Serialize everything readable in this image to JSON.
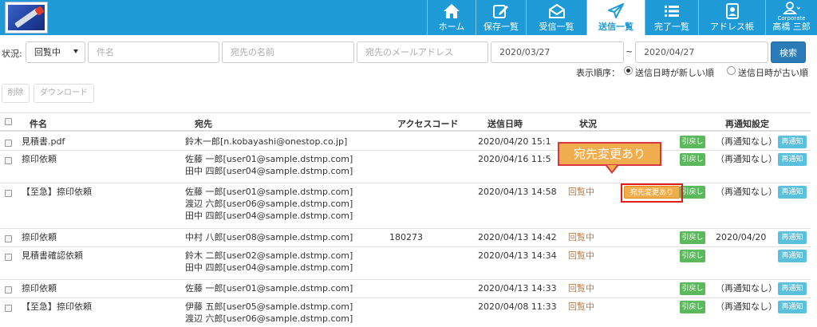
{
  "nav": {
    "home": "ホーム",
    "saved": "保存一覧",
    "inbox": "受信一覧",
    "sent": "送信一覧",
    "done": "完了一覧",
    "address": "アドレス帳",
    "corp": "Corporate",
    "user": "高橋 三郎"
  },
  "filter": {
    "label": "状況:",
    "status_value": "回覧中",
    "subject_placeholder": "件名",
    "recipient_name_placeholder": "宛先の名前",
    "recipient_email_placeholder": "宛先のメールアドレス",
    "date_from": "2020/03/27",
    "tilde": "~",
    "date_to": "2020/04/27",
    "search_label": "検索"
  },
  "order": {
    "label": "表示順序：",
    "newest": "送信日時が新しい順",
    "oldest": "送信日時が古い順"
  },
  "toolbar": {
    "delete": "削除",
    "download": "ダウンロード"
  },
  "columns": {
    "subject": "件名",
    "recipient": "宛先",
    "access_code": "アクセスコード",
    "sent_at": "送信日時",
    "status": "状況",
    "renotify": "再通知設定"
  },
  "callout": "宛先変更あり",
  "actions": {
    "recall": "引戻し",
    "renotify": "再通知"
  },
  "rows": [
    {
      "subject": "見積書.pdf",
      "recipients": [
        "鈴木一郎[n.kobayashi@onestop.co.jp]"
      ],
      "code": "",
      "sent": "2020/04/20 15:1",
      "status": "",
      "badge": "",
      "renotify": "（再通知なし）"
    },
    {
      "subject": "捺印依頼",
      "recipients": [
        "佐藤 一郎[user01@sample.dstmp.com]",
        "田中 四郎[user04@sample.dstmp.com]"
      ],
      "code": "",
      "sent": "2020/04/16 11:5",
      "status": "",
      "badge": "",
      "renotify": "（再通知なし）"
    },
    {
      "subject": "【至急】捺印依頼",
      "recipients": [
        "佐藤 一郎[user01@sample.dstmp.com]",
        "渡辺 六郎[user06@sample.dstmp.com]",
        "田中 四郎[user04@sample.dstmp.com]"
      ],
      "code": "",
      "sent": "2020/04/13 14:58",
      "status": "回覧中",
      "badge": "宛先変更あり",
      "renotify": "（再通知なし）"
    },
    {
      "subject": "捺印依頼",
      "recipients": [
        "中村 八郎[user08@sample.dstmp.com]"
      ],
      "code": "180273",
      "sent": "2020/04/13 14:42",
      "status": "回覧中",
      "badge": "",
      "renotify": "2020/04/20"
    },
    {
      "subject": "見積書確認依頼",
      "recipients": [
        "鈴木 二郎[user02@sample.dstmp.com]",
        "田中 四郎[user04@sample.dstmp.com]"
      ],
      "code": "",
      "sent": "2020/04/13 14:34",
      "status": "回覧中",
      "badge": "",
      "renotify": ""
    },
    {
      "subject": "捺印依頼",
      "recipients": [
        "佐藤 一郎[user01@sample.dstmp.com]"
      ],
      "code": "",
      "sent": "2020/04/13 14:33",
      "status": "回覧中",
      "badge": "",
      "renotify": "（再通知なし）"
    },
    {
      "subject": "【至急】捺印依頼",
      "recipients": [
        "伊藤 五郎[user05@sample.dstmp.com]",
        "渡辺 六郎[user06@sample.dstmp.com]"
      ],
      "code": "",
      "sent": "2020/04/08 11:33",
      "status": "回覧中",
      "badge": "",
      "renotify": "（再通知なし）"
    }
  ]
}
